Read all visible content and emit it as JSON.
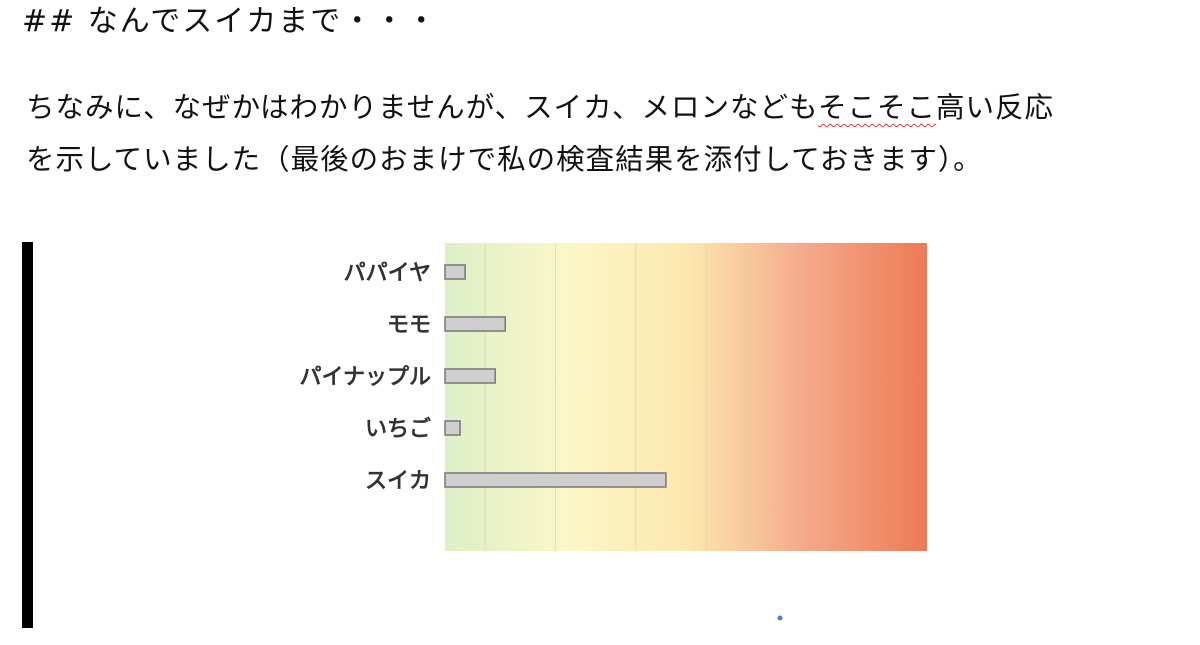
{
  "heading": "## なんでスイカまで・・・",
  "paragraph": {
    "line1_before": "ちなみに、なぜかはわかりませんが、スイカ、メロンなども",
    "line1_underlined": "そこそこ",
    "line1_after": "高い反応",
    "line2": "を示していました（最後のおまけで私の検査結果を添付しておきます）。"
  },
  "chart_data": {
    "type": "bar",
    "orientation": "horizontal",
    "categories": [
      "パパイヤ",
      "モモ",
      "パイナップル",
      "いちご",
      "スイカ"
    ],
    "values": [
      0.2,
      0.6,
      0.5,
      0.15,
      2.2
    ],
    "xlim": [
      0,
      4.8
    ],
    "grid": true,
    "background_gradient": [
      "#dcefc8",
      "#fbf7c8",
      "#fde8b0",
      "#f4a98a",
      "#ee7a55"
    ],
    "bar_color": "#cfcfcf",
    "bar_stroke": "#777777"
  }
}
